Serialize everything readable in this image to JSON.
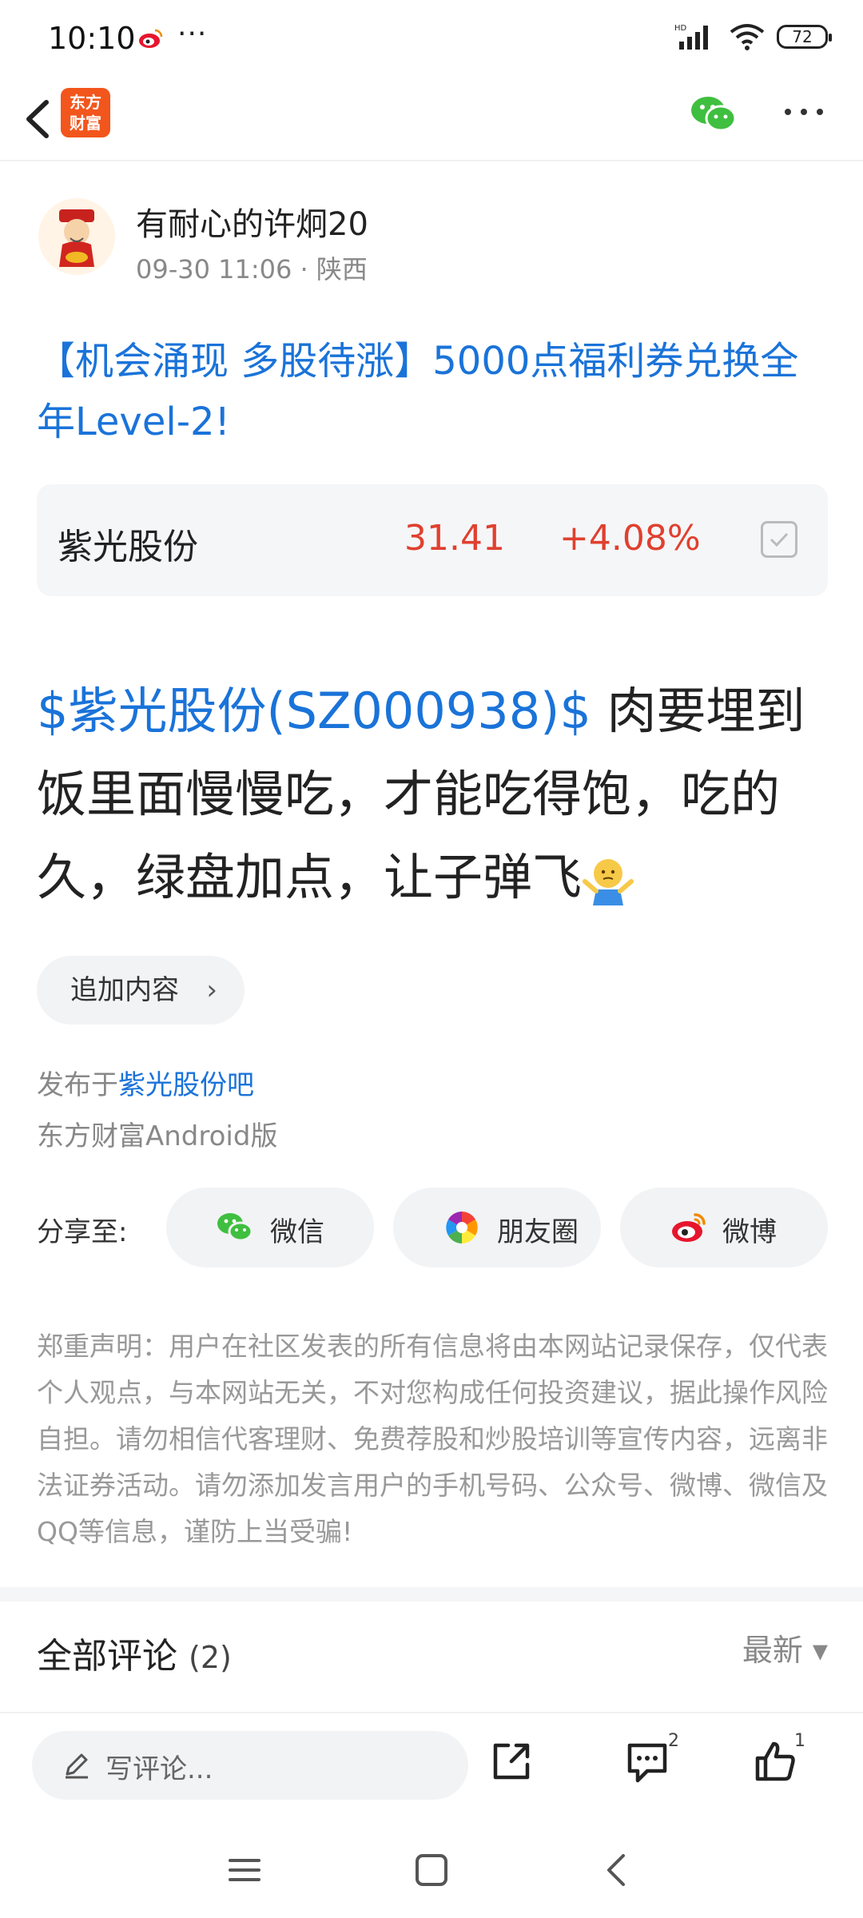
{
  "status_bar": {
    "time": "10:10",
    "dots": "···",
    "battery": "72"
  },
  "header": {
    "logo_text_line1": "东方",
    "logo_text_line2": "财富",
    "back_icon": "chevron-left-icon",
    "share_icon": "wechat-icon",
    "more_icon": "more-dots-icon"
  },
  "author": {
    "name": "有耐心的许炯20",
    "meta": "09-30 11:06 · 陕西"
  },
  "post": {
    "title": "【机会涌现 多股待涨】5000点福利券兑换全年Level-2!",
    "ticker": "$紫光股份(SZ000938)$",
    "body_text": " 肉要埋到饭里面慢慢吃，才能吃得饱，吃的久，绿盘加点，让子弹飞",
    "emoji": "shrug-emoji"
  },
  "stock_card": {
    "name": "紫光股份",
    "price": "31.41",
    "change": "+4.08%",
    "price_color": "#e0402f"
  },
  "append": {
    "label": "追加内容",
    "chevron": "›"
  },
  "published": {
    "prefix": "发布于",
    "bar_name": "紫光股份吧",
    "client": "东方财富Android版"
  },
  "share": {
    "label": "分享至:",
    "targets": [
      {
        "label": "微信",
        "icon": "wechat-icon"
      },
      {
        "label": "朋友圈",
        "icon": "moments-icon"
      },
      {
        "label": "微博",
        "icon": "weibo-icon"
      }
    ]
  },
  "disclaimer": "郑重声明：用户在社区发表的所有信息将由本网站记录保存，仅代表个人观点，与本网站无关，不对您构成任何投资建议，据此操作风险自担。请勿相信代客理财、免费荐股和炒股培训等宣传内容，远离非法证券活动。请勿添加发言用户的手机号码、公众号、微博、微信及QQ等信息，谨防上当受骗!",
  "comments": {
    "title": "全部评论",
    "count": "(2)",
    "sort": "最新 ▾"
  },
  "action_bar": {
    "placeholder": "写评论...",
    "comment_count": "2",
    "like_count": "1"
  },
  "colors": {
    "accent_blue": "#1a73d9",
    "rise_red": "#e0402f",
    "brand_orange": "#f2561d"
  }
}
